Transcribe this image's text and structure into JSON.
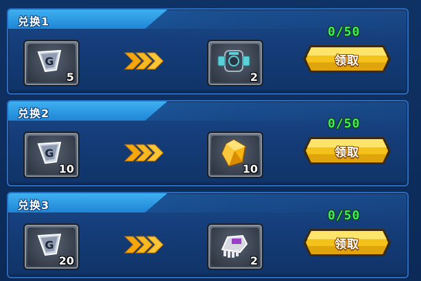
{
  "colors": {
    "panel": "#143c78",
    "title_tab": "#2a97e2",
    "progress_text": "#3df05a",
    "button_gold": "#f4c21a",
    "arrow_gold": "#f6a70d"
  },
  "exchanges": [
    {
      "title": "兑换1",
      "cost_icon": "g-token-icon",
      "cost_count": "5",
      "arrow_icon": "triple-chevron-right-icon",
      "reward_icon": "mech-core-icon",
      "reward_count": "2",
      "progress": "0/50",
      "button_label": "领取"
    },
    {
      "title": "兑换2",
      "cost_icon": "g-token-icon",
      "cost_count": "10",
      "arrow_icon": "triple-chevron-right-icon",
      "reward_icon": "gold-gem-icon",
      "reward_count": "10",
      "progress": "0/50",
      "button_label": "领取"
    },
    {
      "title": "兑换3",
      "cost_icon": "g-token-icon",
      "cost_count": "20",
      "arrow_icon": "triple-chevron-right-icon",
      "reward_icon": "mech-part-icon",
      "reward_count": "2",
      "progress": "0/50",
      "button_label": "领取"
    }
  ]
}
